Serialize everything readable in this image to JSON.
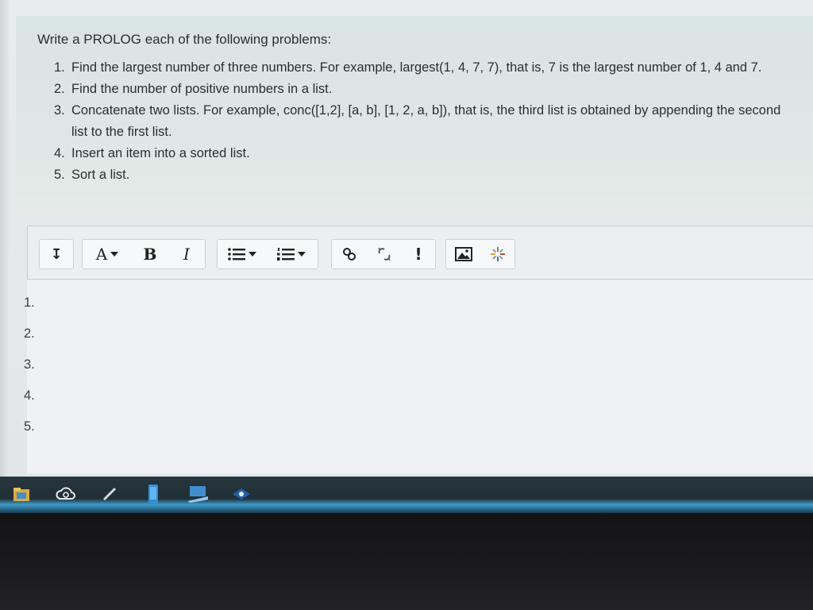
{
  "question": {
    "title": "Write a PROLOG  each of the following problems:",
    "items": [
      {
        "num": "1.",
        "text": "Find the largest number of three numbers.  For example, largest(1, 4, 7, 7), that is, 7 is the largest number of 1, 4 and 7."
      },
      {
        "num": "2.",
        "text": "Find the number of positive numbers in a list."
      },
      {
        "num": "3.",
        "text": "Concatenate two lists.  For example, conc([1,2], [a, b], [1, 2, a, b]), that is, the third list is obtained by appending the second list to the first list."
      },
      {
        "num": "4.",
        "text": "Insert an item into a sorted list."
      },
      {
        "num": "5.",
        "text": "Sort a list."
      }
    ]
  },
  "toolbar": {
    "collapse": "↧",
    "font_color": "A",
    "bold": "B",
    "italic": "I",
    "link": "🔗",
    "unlink": "⛓",
    "emoji": "!",
    "image": "▣",
    "media": "✳"
  },
  "editor": {
    "line_numbers": [
      "1.",
      "2.",
      "3.",
      "4.",
      "5."
    ]
  },
  "colors": {
    "accent": "#3a9ed0",
    "question_bg": "#dde7e5",
    "taskbar": "#22323a"
  }
}
